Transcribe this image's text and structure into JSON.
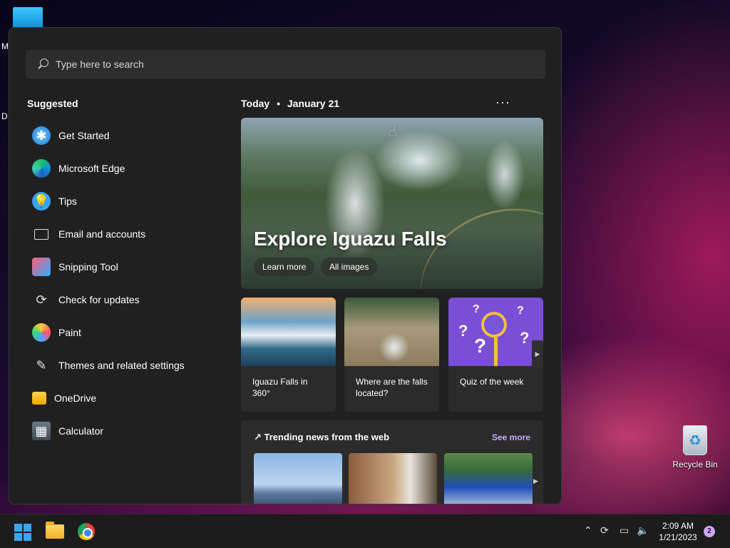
{
  "desktop": {
    "recycle_bin_label": "Recycle Bin",
    "clipped_label_1": "M",
    "clipped_label_2": "D"
  },
  "start": {
    "search_placeholder": "Type here to search",
    "suggested_title": "Suggested",
    "suggested": [
      {
        "label": "Get Started",
        "icon": "get-started-icon"
      },
      {
        "label": "Microsoft Edge",
        "icon": "edge-icon"
      },
      {
        "label": "Tips",
        "icon": "tips-icon"
      },
      {
        "label": "Email and accounts",
        "icon": "mail-icon"
      },
      {
        "label": "Snipping Tool",
        "icon": "snipping-tool-icon"
      },
      {
        "label": "Check for updates",
        "icon": "refresh-icon"
      },
      {
        "label": "Paint",
        "icon": "paint-icon"
      },
      {
        "label": "Themes and related settings",
        "icon": "brush-icon"
      },
      {
        "label": "OneDrive",
        "icon": "onedrive-icon"
      },
      {
        "label": "Calculator",
        "icon": "calculator-icon"
      }
    ],
    "today_label": "Today",
    "date_label": "January 21",
    "more_label": "···",
    "hero": {
      "title": "Explore Iguazu Falls",
      "learn_more": "Learn more",
      "all_images": "All images"
    },
    "cards": [
      {
        "title": "Iguazu Falls in 360°"
      },
      {
        "title": "Where are the falls located?"
      },
      {
        "title": "Quiz of the week"
      }
    ],
    "trending": {
      "title": "Trending news from the web",
      "see_more": "See more"
    }
  },
  "taskbar": {
    "time": "2:09 AM",
    "date": "1/21/2023",
    "notification_count": "2"
  }
}
